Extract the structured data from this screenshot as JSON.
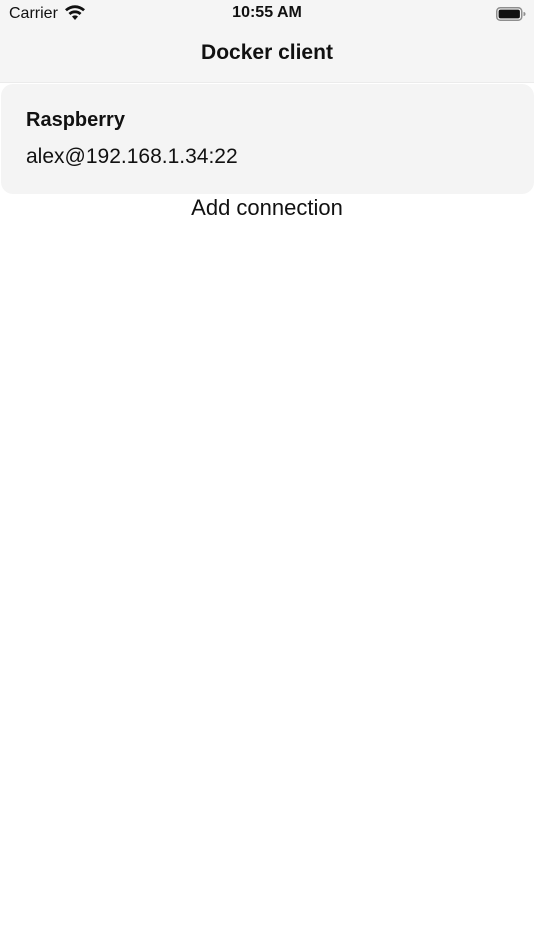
{
  "status_bar": {
    "carrier": "Carrier",
    "time": "10:55 AM",
    "wifi_icon": "wifi-icon",
    "battery_icon": "battery-icon"
  },
  "nav": {
    "title": "Docker client"
  },
  "connections": [
    {
      "name": "Raspberry",
      "address": "alex@192.168.1.34:22"
    }
  ],
  "add_connection_label": "Add connection",
  "colors": {
    "bar_background": "#f5f5f5",
    "card_background": "#f4f4f4",
    "text": "#111111"
  }
}
